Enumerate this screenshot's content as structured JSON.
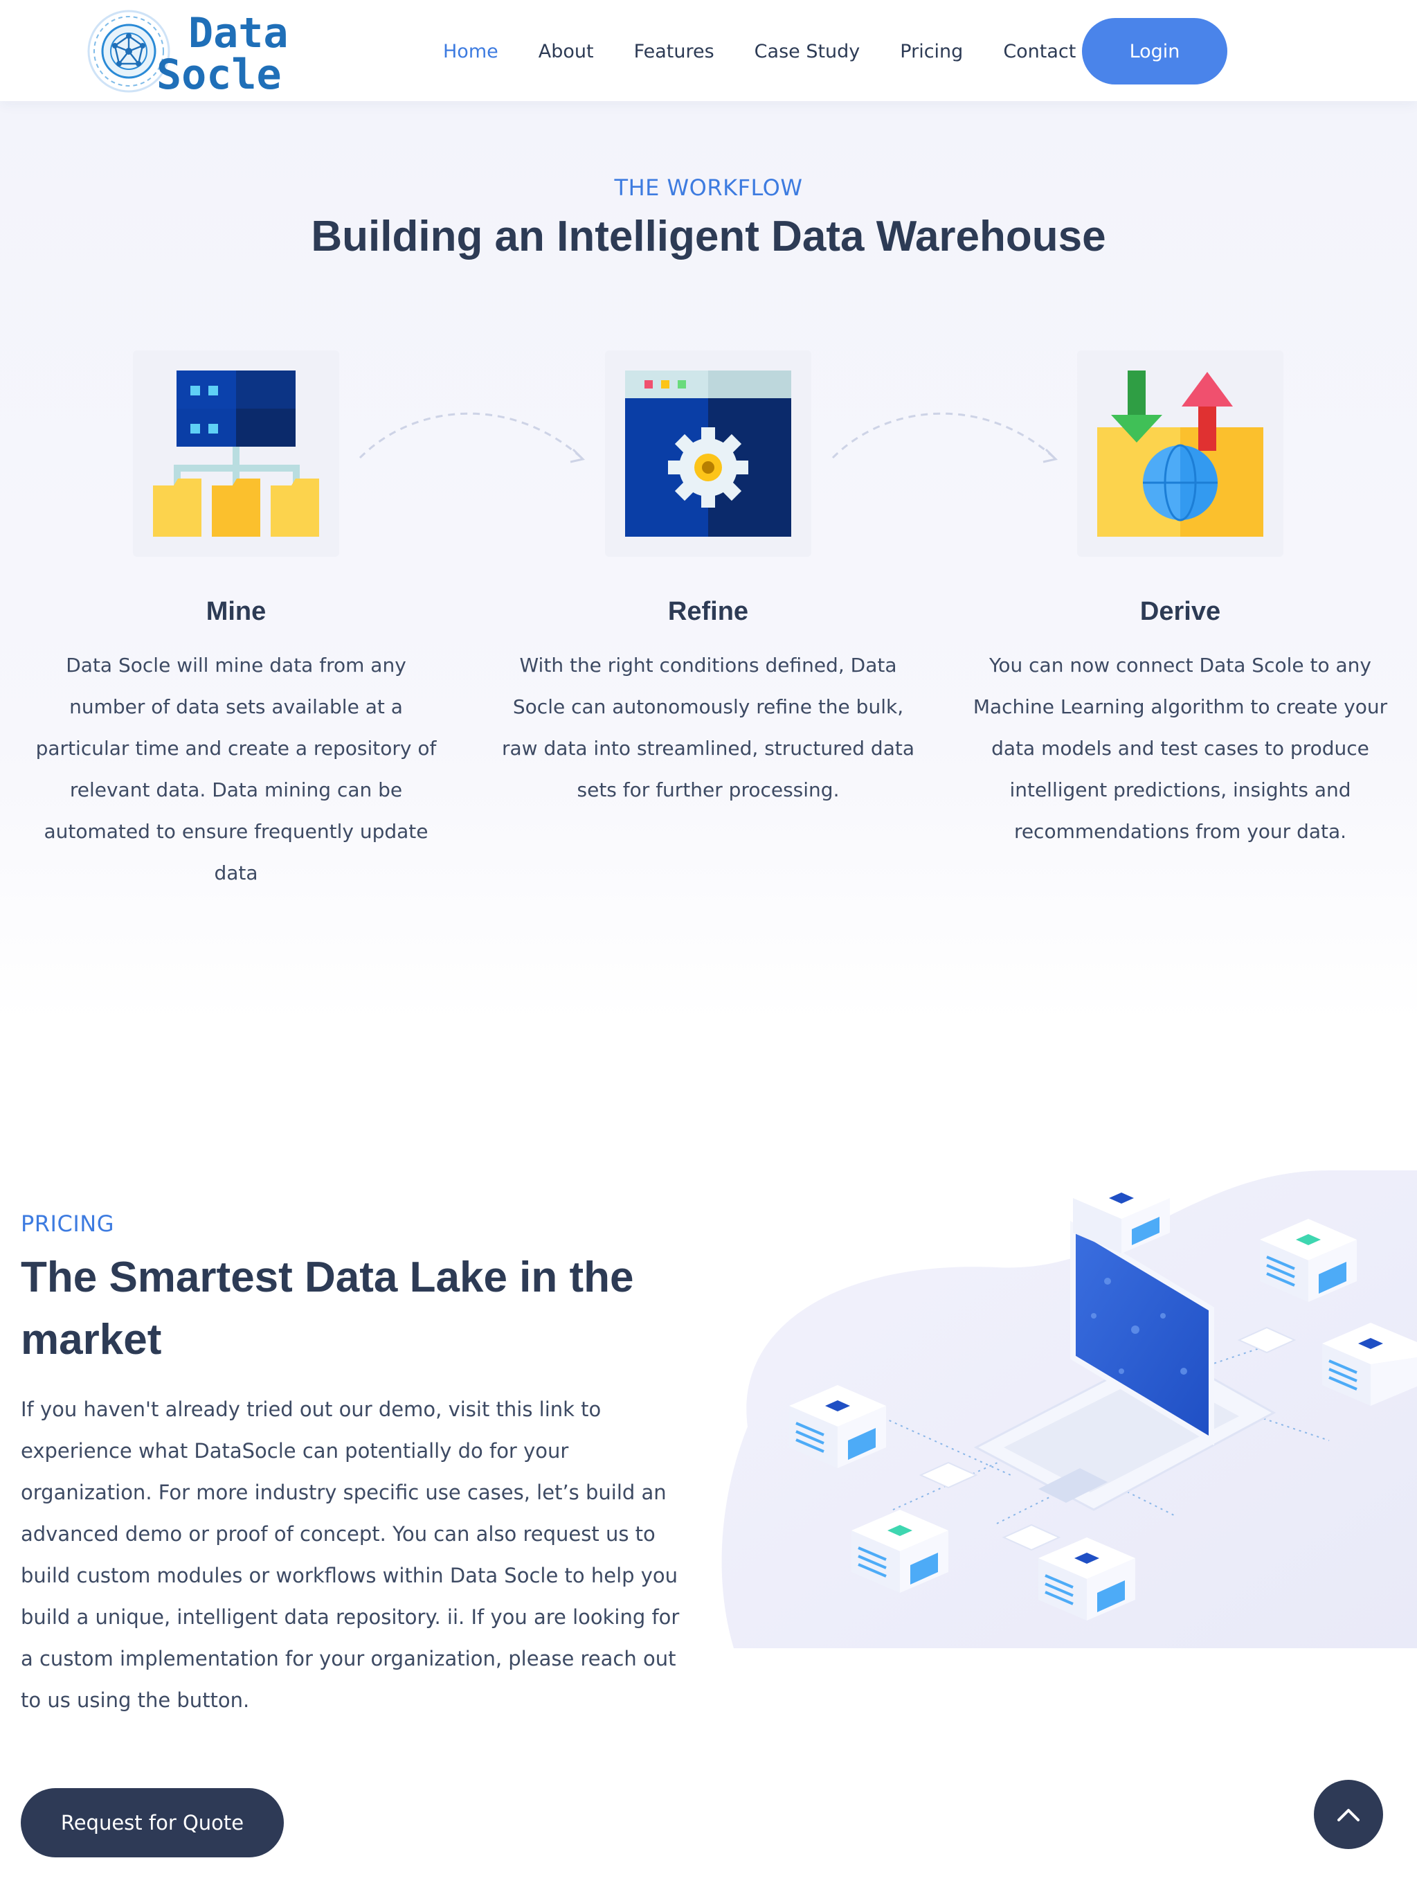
{
  "brand": {
    "logo_line1": "Data",
    "logo_line2": "Socle"
  },
  "nav": {
    "items": [
      {
        "label": "Home",
        "active": true
      },
      {
        "label": "About"
      },
      {
        "label": "Features"
      },
      {
        "label": "Case Study"
      },
      {
        "label": "Pricing"
      },
      {
        "label": "Contact"
      }
    ],
    "login_label": "Login"
  },
  "workflow": {
    "eyebrow": "THE WORKFLOW",
    "title": "Building an Intelligent Data Warehouse",
    "steps": [
      {
        "icon": "data-mining-icon",
        "title": "Mine",
        "lines": [
          "Data Socle will mine data from any",
          "number of data sets available at a",
          "particular time and create a repository of",
          "relevant data. Data mining can be",
          "automated to ensure frequently update",
          "data"
        ]
      },
      {
        "icon": "gear-window-icon",
        "title": "Refine",
        "lines": [
          "With the right conditions defined, Data",
          "Socle can autonomously refine the bulk,",
          "raw data into streamlined, structured data",
          "sets for further processing."
        ]
      },
      {
        "icon": "folder-globe-icon",
        "title": "Derive",
        "lines": [
          "You can now connect Data Scole to any",
          "Machine Learning algorithm to create your",
          "data models and test cases to produce",
          "intelligent predictions, insights and",
          "recommendations from your data."
        ]
      }
    ]
  },
  "pricing": {
    "eyebrow": "PRICING",
    "title_lines": [
      "The Smartest Data Lake in the",
      "market"
    ],
    "text_lines": [
      "If you haven't already tried out our demo, visit this link to",
      "experience what DataSocle can potentially do for your",
      "organization. For more industry specific use cases, let’s build an",
      "advanced demo or proof of concept. You can also request us to",
      "build custom modules or workflows within Data Socle to help you",
      "build a unique, intelligent data repository. ii. If you are looking for",
      "a custom implementation for your organization, please reach out",
      "to us using the button."
    ],
    "button_label": "Request for Quote"
  },
  "colors": {
    "accent": "#4a84ea",
    "heading": "#2d3b55",
    "dark_button": "#2e3a56",
    "section_bg": "#f3f4fb"
  },
  "icons": {
    "scroll_top": "chevron-up-icon"
  }
}
